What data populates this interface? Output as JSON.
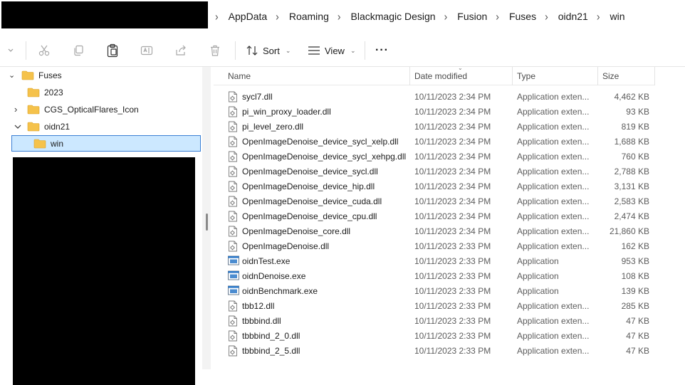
{
  "breadcrumb": [
    "AppData",
    "Roaming",
    "Blackmagic Design",
    "Fusion",
    "Fuses",
    "oidn21",
    "win"
  ],
  "toolbar": {
    "sort_label": "Sort",
    "view_label": "View",
    "more_label": "···"
  },
  "nav": {
    "items": [
      {
        "label": "Fuses",
        "chevron": "✓"
      },
      {
        "label": "2023",
        "chevron": ""
      },
      {
        "label": "CGS_OpticalFlares_Icon",
        "chevron": "›"
      },
      {
        "label": "oidn21",
        "chevron": "⌄"
      },
      {
        "label": "win",
        "chevron": ""
      }
    ]
  },
  "columns": {
    "name": "Name",
    "date": "Date modified",
    "type": "Type",
    "size": "Size"
  },
  "files": [
    {
      "name": "sycl7.dll",
      "date": "10/11/2023 2:34 PM",
      "type": "Application exten...",
      "size": "4,462 KB",
      "icon": "dll-icon"
    },
    {
      "name": "pi_win_proxy_loader.dll",
      "date": "10/11/2023 2:34 PM",
      "type": "Application exten...",
      "size": "93 KB",
      "icon": "dll-icon"
    },
    {
      "name": "pi_level_zero.dll",
      "date": "10/11/2023 2:34 PM",
      "type": "Application exten...",
      "size": "819 KB",
      "icon": "dll-icon"
    },
    {
      "name": "OpenImageDenoise_device_sycl_xelp.dll",
      "date": "10/11/2023 2:34 PM",
      "type": "Application exten...",
      "size": "1,688 KB",
      "icon": "dll-icon"
    },
    {
      "name": "OpenImageDenoise_device_sycl_xehpg.dll",
      "date": "10/11/2023 2:34 PM",
      "type": "Application exten...",
      "size": "760 KB",
      "icon": "dll-icon"
    },
    {
      "name": "OpenImageDenoise_device_sycl.dll",
      "date": "10/11/2023 2:34 PM",
      "type": "Application exten...",
      "size": "2,788 KB",
      "icon": "dll-icon"
    },
    {
      "name": "OpenImageDenoise_device_hip.dll",
      "date": "10/11/2023 2:34 PM",
      "type": "Application exten...",
      "size": "3,131 KB",
      "icon": "dll-icon"
    },
    {
      "name": "OpenImageDenoise_device_cuda.dll",
      "date": "10/11/2023 2:34 PM",
      "type": "Application exten...",
      "size": "2,583 KB",
      "icon": "dll-icon"
    },
    {
      "name": "OpenImageDenoise_device_cpu.dll",
      "date": "10/11/2023 2:34 PM",
      "type": "Application exten...",
      "size": "2,474 KB",
      "icon": "dll-icon"
    },
    {
      "name": "OpenImageDenoise_core.dll",
      "date": "10/11/2023 2:34 PM",
      "type": "Application exten...",
      "size": "21,860 KB",
      "icon": "dll-icon"
    },
    {
      "name": "OpenImageDenoise.dll",
      "date": "10/11/2023 2:33 PM",
      "type": "Application exten...",
      "size": "162 KB",
      "icon": "dll-icon"
    },
    {
      "name": "oidnTest.exe",
      "date": "10/11/2023 2:33 PM",
      "type": "Application",
      "size": "953 KB",
      "icon": "exe-icon"
    },
    {
      "name": "oidnDenoise.exe",
      "date": "10/11/2023 2:33 PM",
      "type": "Application",
      "size": "108 KB",
      "icon": "exe-icon"
    },
    {
      "name": "oidnBenchmark.exe",
      "date": "10/11/2023 2:33 PM",
      "type": "Application",
      "size": "139 KB",
      "icon": "exe-icon"
    },
    {
      "name": "tbb12.dll",
      "date": "10/11/2023 2:33 PM",
      "type": "Application exten...",
      "size": "285 KB",
      "icon": "dll-icon"
    },
    {
      "name": "tbbbind.dll",
      "date": "10/11/2023 2:33 PM",
      "type": "Application exten...",
      "size": "47 KB",
      "icon": "dll-icon"
    },
    {
      "name": "tbbbind_2_0.dll",
      "date": "10/11/2023 2:33 PM",
      "type": "Application exten...",
      "size": "47 KB",
      "icon": "dll-icon"
    },
    {
      "name": "tbbbind_2_5.dll",
      "date": "10/11/2023 2:33 PM",
      "type": "Application exten...",
      "size": "47 KB",
      "icon": "dll-icon"
    }
  ],
  "colors": {
    "selection_bg": "#cce8ff",
    "selection_border": "#3b7fd4",
    "folder": "#f5c24b",
    "exe_accent": "#2b78c8"
  }
}
